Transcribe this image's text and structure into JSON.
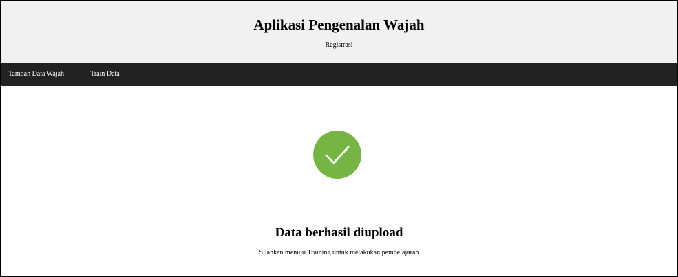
{
  "header": {
    "title": "Aplikasi Pengenalan Wajah",
    "subtitle": "Registrasi"
  },
  "nav": {
    "items": [
      {
        "label": "Tambah Data Wajah"
      },
      {
        "label": "Train Data"
      }
    ]
  },
  "main": {
    "icon": "check-circle-icon",
    "title": "Data berhasil diupload",
    "message": "Silahkan menuju Training untuk melakukan pembelajaran"
  },
  "colors": {
    "header_bg": "#f1f1f1",
    "nav_bg": "#222222",
    "success": "#76b443"
  }
}
